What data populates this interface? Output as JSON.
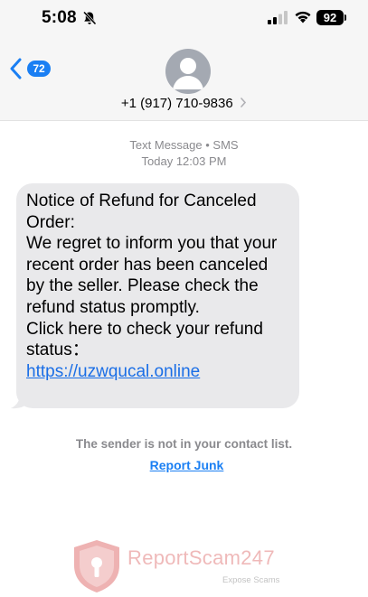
{
  "status_bar": {
    "time": "5:08",
    "battery": "92",
    "icons": [
      "bell-slash-icon",
      "signal-icon",
      "wifi-icon",
      "battery-icon"
    ]
  },
  "header": {
    "back_badge": "72",
    "contact_number": "+1 (917) 710-9836"
  },
  "conversation": {
    "service": "Text Message • SMS",
    "timestamp": "Today 12:03 PM",
    "message": {
      "line1": "Notice of Refund for Canceled Order:",
      "line2": "We regret to inform you that your recent order has been canceled by the seller. Please check the refund status promptly.",
      "line3": "Click here to check your refund status：",
      "link": "https://uzwqucal.online"
    },
    "sender_notice": "The sender is not in your contact list.",
    "report_junk": "Report Junk"
  },
  "watermark": {
    "brand": "ReportScam247",
    "tagline": "Expose Scams"
  },
  "colors": {
    "accent": "#1a7ff3",
    "bubble": "#e9e9eb",
    "link": "#1a6ee6",
    "muted": "#8a8a8e"
  }
}
